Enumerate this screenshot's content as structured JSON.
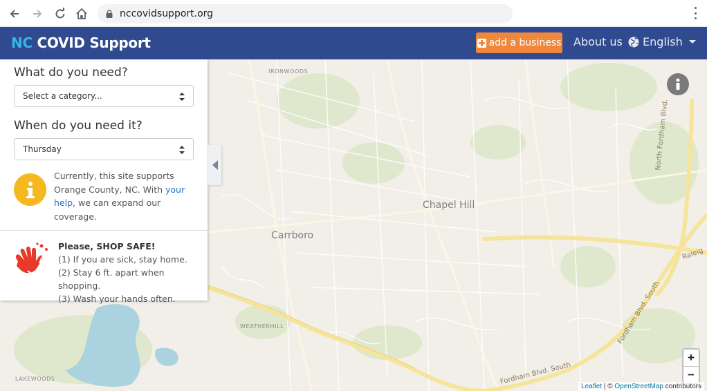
{
  "browser": {
    "url": "nccovidsupport.org"
  },
  "header": {
    "brand_nc": "NC",
    "brand_rest": "COVID Support",
    "add_business": "add a business",
    "about": "About us",
    "language": "English"
  },
  "sidebar": {
    "need_title": "What do you need?",
    "category_value": "Select a category...",
    "when_title": "When do you need it?",
    "day_value": "Thursday",
    "info_part1": "Currently, this site supports Orange County, NC. With ",
    "info_link": "your help",
    "info_part2": ", we can expand our coverage.",
    "safe_heading": "Please, SHOP SAFE!",
    "safe_line1": "(1) If you are sick, stay home.",
    "safe_line2": "(2) Stay 6 ft. apart when shopping.",
    "safe_line3": "(3) Wash your hands often."
  },
  "map": {
    "labels": {
      "chapel_hill": "Chapel Hill",
      "carrboro": "Carrboro",
      "ironwoods": "IRONWOODS",
      "weatherhill": "WEATHERHILL",
      "lakewoods": "LAKEWOODS",
      "north_fordham": "North Fordham Blvd.",
      "fordham_south_1": "Fordham Blvd. South",
      "fordham_south_2": "Fordham Blvd. South",
      "raleigh": "Raleig"
    },
    "zoom_in": "+",
    "zoom_out": "−",
    "attribution_leaflet": "Leaflet",
    "attribution_sep": " | © ",
    "attribution_osm": "OpenStreetMap",
    "attribution_tail": " contributors"
  },
  "colors": {
    "header": "#2f4a8f",
    "brand_accent": "#35b5e8",
    "button": "#f0883c",
    "info_yellow": "#f6b820",
    "hands_red": "#e8392a"
  }
}
